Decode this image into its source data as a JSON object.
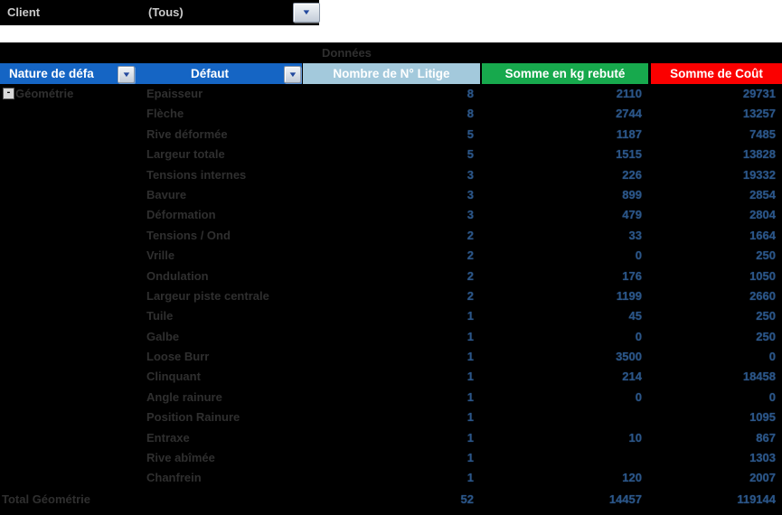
{
  "filter": {
    "label": "Client",
    "value": "(Tous)"
  },
  "data_area_label": "Données",
  "icons": {
    "dropdown": "▼",
    "collapse": "-"
  },
  "columns": {
    "nature": "Nature de défa",
    "defaut": "Défaut",
    "nombre": "Nombre de N° Litige",
    "kg": "Somme en kg rebuté",
    "cout": "Somme de Coût"
  },
  "group": {
    "name": "Géométrie"
  },
  "rows": [
    {
      "defaut": "Epaisseur",
      "nombre": "8",
      "kg": "2110",
      "cout": "29731"
    },
    {
      "defaut": "Flèche",
      "nombre": "8",
      "kg": "2744",
      "cout": "13257"
    },
    {
      "defaut": "Rive déformée",
      "nombre": "5",
      "kg": "1187",
      "cout": "7485"
    },
    {
      "defaut": "Largeur totale",
      "nombre": "5",
      "kg": "1515",
      "cout": "13828"
    },
    {
      "defaut": "Tensions internes",
      "nombre": "3",
      "kg": "226",
      "cout": "19332"
    },
    {
      "defaut": "Bavure",
      "nombre": "3",
      "kg": "899",
      "cout": "2854"
    },
    {
      "defaut": "Déformation",
      "nombre": "3",
      "kg": "479",
      "cout": "2804"
    },
    {
      "defaut": "Tensions / Ond",
      "nombre": "2",
      "kg": "33",
      "cout": "1664"
    },
    {
      "defaut": "Vrille",
      "nombre": "2",
      "kg": "0",
      "cout": "250"
    },
    {
      "defaut": "Ondulation",
      "nombre": "2",
      "kg": "176",
      "cout": "1050"
    },
    {
      "defaut": "Largeur piste centrale",
      "nombre": "2",
      "kg": "1199",
      "cout": "2660"
    },
    {
      "defaut": "Tuile",
      "nombre": "1",
      "kg": "45",
      "cout": "250"
    },
    {
      "defaut": "Galbe",
      "nombre": "1",
      "kg": "0",
      "cout": "250"
    },
    {
      "defaut": "Loose Burr",
      "nombre": "1",
      "kg": "3500",
      "cout": "0"
    },
    {
      "defaut": "Clinquant",
      "nombre": "1",
      "kg": "214",
      "cout": "18458"
    },
    {
      "defaut": "Angle rainure",
      "nombre": "1",
      "kg": "0",
      "cout": "0"
    },
    {
      "defaut": "Position Rainure",
      "nombre": "1",
      "kg": "",
      "cout": "1095"
    },
    {
      "defaut": "Entraxe",
      "nombre": "1",
      "kg": "10",
      "cout": "867"
    },
    {
      "defaut": "Rive abîmée",
      "nombre": "1",
      "kg": "",
      "cout": "1303"
    },
    {
      "defaut": "Chanfrein",
      "nombre": "1",
      "kg": "120",
      "cout": "2007"
    }
  ],
  "total": {
    "label": "Total Géométrie",
    "nombre": "52",
    "kg": "14457",
    "cout": "119144"
  },
  "colors": {
    "header_blue": "#1565C4",
    "header_teal": "#A3C9DC",
    "header_green": "#17A94D",
    "header_red": "#FB0000",
    "header_text": "#FFFFFF",
    "label_text": "#2F2F2F",
    "number_text": "#2B5688",
    "filter_text": "#C9C9C9",
    "background": "#000000"
  }
}
